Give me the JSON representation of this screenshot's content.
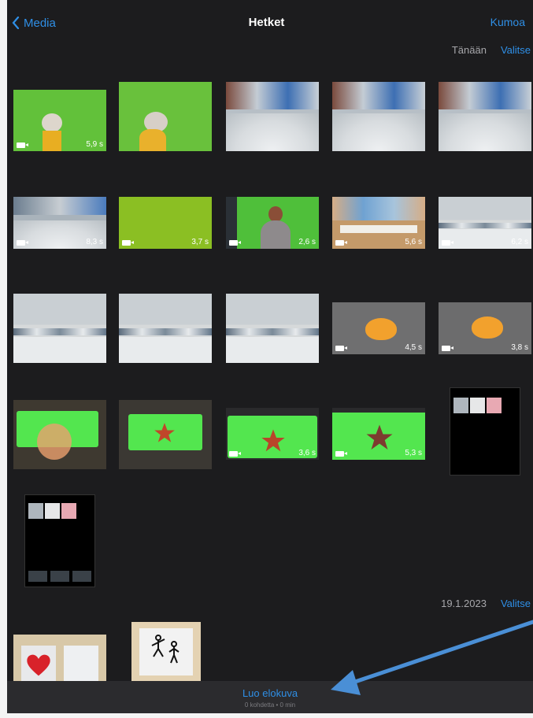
{
  "nav": {
    "back_label": "Media",
    "title": "Hetket",
    "right_action": "Kumoa"
  },
  "sections": [
    {
      "date": "Tänään",
      "select": "Valitse"
    },
    {
      "date": "19.1.2023",
      "select": "Valitse"
    }
  ],
  "thumbs": [
    {
      "duration": "5,9 s"
    },
    {
      "duration": ""
    },
    {
      "duration": ""
    },
    {
      "duration": ""
    },
    {
      "duration": ""
    },
    {
      "duration": "8,3 s"
    },
    {
      "duration": "3,7 s"
    },
    {
      "duration": "2,6 s"
    },
    {
      "duration": "5,6 s"
    },
    {
      "duration": "6,2 s"
    },
    {
      "duration": ""
    },
    {
      "duration": ""
    },
    {
      "duration": ""
    },
    {
      "duration": "4,5 s"
    },
    {
      "duration": "3,8 s"
    },
    {
      "duration": ""
    },
    {
      "duration": ""
    },
    {
      "duration": "3,6 s"
    },
    {
      "duration": "5,3 s"
    }
  ],
  "bottom": {
    "create_label": "Luo elokuva",
    "sub_label": "0 kohdetta • 0 min"
  },
  "colors": {
    "accent": "#2f8fe6",
    "background": "#1c1c1e",
    "green_screen": "#53e64f",
    "arrow": "#4a8fd6"
  }
}
